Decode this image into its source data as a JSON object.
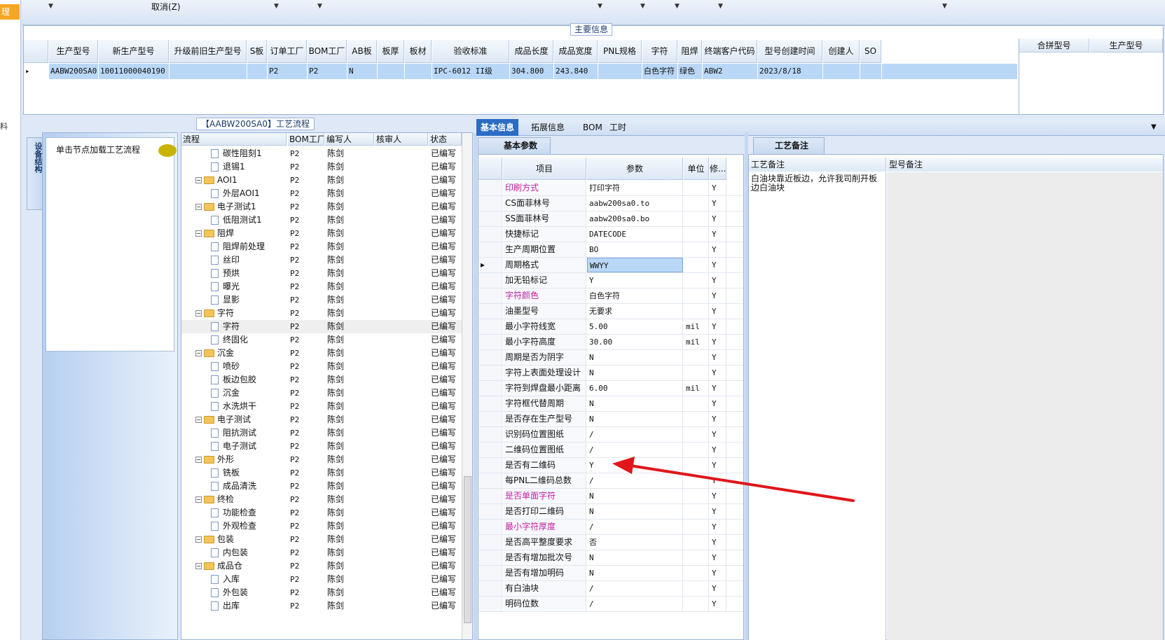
{
  "left_strip": {
    "tab1": "理",
    "tab2": "料"
  },
  "toolbar": {
    "cancel_label": "取消(Z)"
  },
  "main_info": {
    "legend": "主要信息",
    "columns": [
      "生产型号",
      "新生产型号",
      "升级前旧生产型号",
      "S板",
      "订单工厂",
      "BOM工厂",
      "AB板",
      "板厚",
      "板材",
      "验收标准",
      "成品长度",
      "成品宽度",
      "PNL规格",
      "字符",
      "阻焊",
      "终端客户代码",
      "型号创建时间",
      "创建人",
      "SO"
    ],
    "row": [
      "AABW200SA0",
      "10011000040190",
      "",
      "",
      "P2",
      "P2",
      "N",
      "",
      "",
      "IPC-6012 II级",
      "304.800",
      "243.840",
      "",
      "白色字符",
      "绿色",
      "ABW2",
      "2023/8/18",
      "",
      ""
    ],
    "merge_columns": [
      "合拼型号",
      "生产型号"
    ]
  },
  "left_panel": {
    "vtab": "设备结构",
    "node_hint": "单击节点加载工艺流程",
    "flow_title": "【AABW200SA0】工艺流程"
  },
  "tree": {
    "columns": [
      "流程",
      "BOM工厂",
      "编写人",
      "核审人",
      "状态"
    ],
    "rows": [
      {
        "level": 2,
        "name": "碳性阻刻1",
        "bom": "P2",
        "writer": "陈剑",
        "reviewer": "",
        "status": "已编写"
      },
      {
        "level": 2,
        "name": "退锡1",
        "bom": "P2",
        "writer": "陈剑",
        "reviewer": "",
        "status": "已编写"
      },
      {
        "level": 1,
        "name": "AOI1",
        "bom": "P2",
        "writer": "陈剑",
        "reviewer": "",
        "status": "已编写"
      },
      {
        "level": 2,
        "name": "外层AOI1",
        "bom": "P2",
        "writer": "陈剑",
        "reviewer": "",
        "status": "已编写"
      },
      {
        "level": 1,
        "name": "电子测试1",
        "bom": "P2",
        "writer": "陈剑",
        "reviewer": "",
        "status": "已编写"
      },
      {
        "level": 2,
        "name": "低阻测试1",
        "bom": "P2",
        "writer": "陈剑",
        "reviewer": "",
        "status": "已编写"
      },
      {
        "level": 1,
        "name": "阻焊",
        "bom": "P2",
        "writer": "陈剑",
        "reviewer": "",
        "status": "已编写"
      },
      {
        "level": 2,
        "name": "阻焊前处理",
        "bom": "P2",
        "writer": "陈剑",
        "reviewer": "",
        "status": "已编写"
      },
      {
        "level": 2,
        "name": "丝印",
        "bom": "P2",
        "writer": "陈剑",
        "reviewer": "",
        "status": "已编写"
      },
      {
        "level": 2,
        "name": "预烘",
        "bom": "P2",
        "writer": "陈剑",
        "reviewer": "",
        "status": "已编写"
      },
      {
        "level": 2,
        "name": "曝光",
        "bom": "P2",
        "writer": "陈剑",
        "reviewer": "",
        "status": "已编写"
      },
      {
        "level": 2,
        "name": "显影",
        "bom": "P2",
        "writer": "陈剑",
        "reviewer": "",
        "status": "已编写"
      },
      {
        "level": 1,
        "name": "字符",
        "bom": "P2",
        "writer": "陈剑",
        "reviewer": "",
        "status": "已编写"
      },
      {
        "level": 2,
        "name": "字符",
        "bom": "P2",
        "writer": "陈剑",
        "reviewer": "",
        "status": "已编写",
        "selected": true
      },
      {
        "level": 2,
        "name": "终固化",
        "bom": "P2",
        "writer": "陈剑",
        "reviewer": "",
        "status": "已编写"
      },
      {
        "level": 1,
        "name": "沉金",
        "bom": "P2",
        "writer": "陈剑",
        "reviewer": "",
        "status": "已编写"
      },
      {
        "level": 2,
        "name": "喷砂",
        "bom": "P2",
        "writer": "陈剑",
        "reviewer": "",
        "status": "已编写"
      },
      {
        "level": 2,
        "name": "板边包胶",
        "bom": "P2",
        "writer": "陈剑",
        "reviewer": "",
        "status": "已编写"
      },
      {
        "level": 2,
        "name": "沉金",
        "bom": "P2",
        "writer": "陈剑",
        "reviewer": "",
        "status": "已编写"
      },
      {
        "level": 2,
        "name": "水洗烘干",
        "bom": "P2",
        "writer": "陈剑",
        "reviewer": "",
        "status": "已编写"
      },
      {
        "level": 1,
        "name": "电子测试",
        "bom": "P2",
        "writer": "陈剑",
        "reviewer": "",
        "status": "已编写"
      },
      {
        "level": 2,
        "name": "阻抗测试",
        "bom": "P2",
        "writer": "陈剑",
        "reviewer": "",
        "status": "已编写"
      },
      {
        "level": 2,
        "name": "电子测试",
        "bom": "P2",
        "writer": "陈剑",
        "reviewer": "",
        "status": "已编写"
      },
      {
        "level": 1,
        "name": "外形",
        "bom": "P2",
        "writer": "陈剑",
        "reviewer": "",
        "status": "已编写"
      },
      {
        "level": 2,
        "name": "铣板",
        "bom": "P2",
        "writer": "陈剑",
        "reviewer": "",
        "status": "已编写"
      },
      {
        "level": 2,
        "name": "成品清洗",
        "bom": "P2",
        "writer": "陈剑",
        "reviewer": "",
        "status": "已编写"
      },
      {
        "level": 1,
        "name": "终检",
        "bom": "P2",
        "writer": "陈剑",
        "reviewer": "",
        "status": "已编写"
      },
      {
        "level": 2,
        "name": "功能检查",
        "bom": "P2",
        "writer": "陈剑",
        "reviewer": "",
        "status": "已编写"
      },
      {
        "level": 2,
        "name": "外观检查",
        "bom": "P2",
        "writer": "陈剑",
        "reviewer": "",
        "status": "已编写"
      },
      {
        "level": 1,
        "name": "包装",
        "bom": "P2",
        "writer": "陈剑",
        "reviewer": "",
        "status": "已编写"
      },
      {
        "level": 2,
        "name": "内包装",
        "bom": "P2",
        "writer": "陈剑",
        "reviewer": "",
        "status": "已编写"
      },
      {
        "level": 1,
        "name": "成品仓",
        "bom": "P2",
        "writer": "陈剑",
        "reviewer": "",
        "status": "已编写"
      },
      {
        "level": 2,
        "name": "入库",
        "bom": "P2",
        "writer": "陈剑",
        "reviewer": "",
        "status": "已编写"
      },
      {
        "level": 2,
        "name": "外包装",
        "bom": "P2",
        "writer": "陈剑",
        "reviewer": "",
        "status": "已编写"
      },
      {
        "level": 2,
        "name": "出库",
        "bom": "P2",
        "writer": "陈剑",
        "reviewer": "",
        "status": "已编写"
      }
    ]
  },
  "right_tabs": [
    "基本信息",
    "拓展信息",
    "BOM",
    "工时"
  ],
  "basic_params": {
    "title": "基本参数",
    "columns": [
      "项目",
      "参数",
      "单位",
      "修..."
    ],
    "rows": [
      {
        "item": "印刷方式",
        "value": "打印字符",
        "unit": "",
        "flag": "Y",
        "pink": true
      },
      {
        "item": "CS面菲林号",
        "value": "aabw200sa0.to",
        "unit": "",
        "flag": "Y"
      },
      {
        "item": "SS面菲林号",
        "value": "aabw200sa0.bo",
        "unit": "",
        "flag": "Y"
      },
      {
        "item": "快捷标记",
        "value": "DATECODE",
        "unit": "",
        "flag": "Y"
      },
      {
        "item": "生产周期位置",
        "value": "BO",
        "unit": "",
        "flag": "Y"
      },
      {
        "item": "周期格式",
        "value": "WWYY",
        "unit": "",
        "flag": "Y",
        "selected": true
      },
      {
        "item": "加无铅标记",
        "value": "Y",
        "unit": "",
        "flag": "Y"
      },
      {
        "item": "字符颜色",
        "value": "白色字符",
        "unit": "",
        "flag": "Y",
        "pink": true
      },
      {
        "item": "油墨型号",
        "value": "无要求",
        "unit": "",
        "flag": "Y"
      },
      {
        "item": "最小字符线宽",
        "value": "5.00",
        "unit": "mil",
        "flag": "Y"
      },
      {
        "item": "最小字符高度",
        "value": "30.00",
        "unit": "mil",
        "flag": "Y"
      },
      {
        "item": "周期是否为阴字",
        "value": "N",
        "unit": "",
        "flag": "Y"
      },
      {
        "item": "字符上表面处理设计",
        "value": "N",
        "unit": "",
        "flag": "Y"
      },
      {
        "item": "字符到焊盘最小距离",
        "value": "6.00",
        "unit": "mil",
        "flag": "Y"
      },
      {
        "item": "字符框代替周期",
        "value": "N",
        "unit": "",
        "flag": "Y"
      },
      {
        "item": "是否存在生产型号",
        "value": "N",
        "unit": "",
        "flag": "Y"
      },
      {
        "item": "识别码位置图纸",
        "value": "/",
        "unit": "",
        "flag": "Y"
      },
      {
        "item": "二维码位置图纸",
        "value": "/",
        "unit": "",
        "flag": "Y"
      },
      {
        "item": "是否有二维码",
        "value": "Y",
        "unit": "",
        "flag": "Y"
      },
      {
        "item": "每PNL二维码总数",
        "value": "/",
        "unit": "",
        "flag": "Y"
      },
      {
        "item": "是否单面字符",
        "value": "N",
        "unit": "",
        "flag": "Y",
        "pink": true
      },
      {
        "item": "是否打印二维码",
        "value": "N",
        "unit": "",
        "flag": "Y"
      },
      {
        "item": "最小字符厚度",
        "value": "/",
        "unit": "",
        "flag": "Y",
        "pink": true
      },
      {
        "item": "是否高平整度要求",
        "value": "否",
        "unit": "",
        "flag": "Y"
      },
      {
        "item": "是否有增加批次号",
        "value": "N",
        "unit": "",
        "flag": "Y"
      },
      {
        "item": "是否有增加明码",
        "value": "N",
        "unit": "",
        "flag": "Y"
      },
      {
        "item": "有白油块",
        "value": "/",
        "unit": "",
        "flag": "Y"
      },
      {
        "item": "明码位数",
        "value": "/",
        "unit": "",
        "flag": "Y"
      }
    ]
  },
  "process_notes": {
    "title": "工艺备注",
    "col1": "工艺备注",
    "col2": "型号备注",
    "note_text": "白油块靠近板边，允许我司削开板边白油块"
  },
  "colors": {
    "accent": "#2b6cc4",
    "selected_row": "#b9d7f7",
    "pink_label": "#c020a0",
    "arrow": "#e0161b"
  }
}
